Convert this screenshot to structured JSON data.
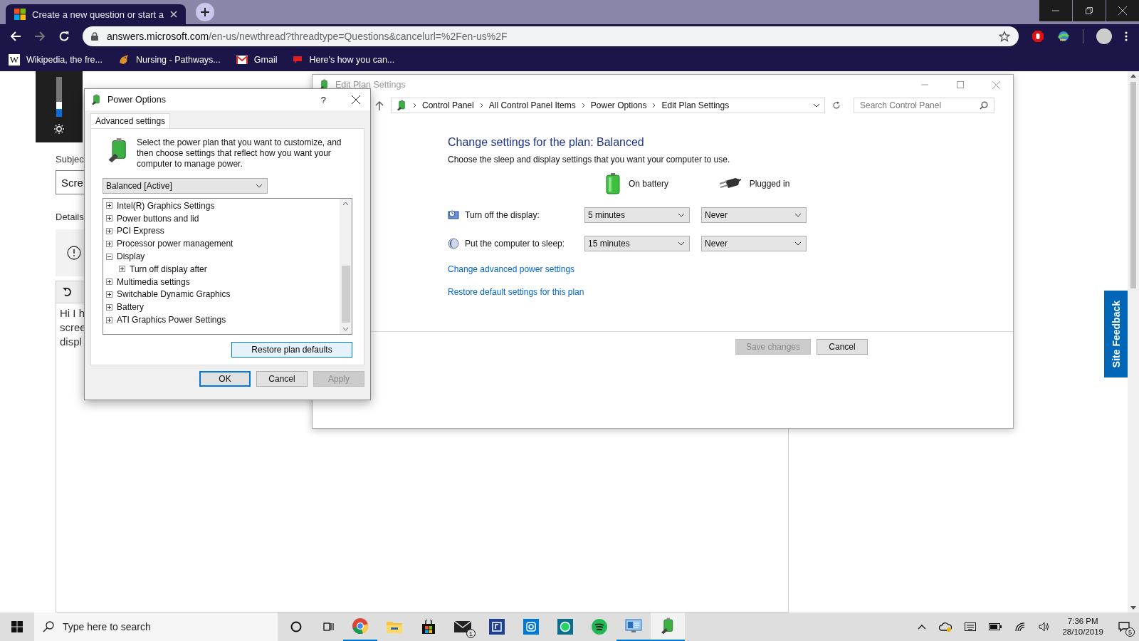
{
  "browser": {
    "tab": {
      "title": "Create a new question or start a",
      "selected": true
    },
    "address": {
      "host": "answers.microsoft.com",
      "path": "/en-us/newthread?threadtype=Questions&cancelurl=%2Fen-us%2F"
    },
    "bookmarks": [
      {
        "kind": "letter",
        "icon": "W",
        "label": "Wikipedia, the fre..."
      },
      {
        "kind": "animal",
        "label": "Nursing - Pathways..."
      },
      {
        "kind": "gmail",
        "label": "Gmail"
      },
      {
        "kind": "red",
        "label": "Here's how you can..."
      }
    ]
  },
  "brightness_flyout": {
    "level": 0.2
  },
  "page": {
    "subject_label": "Subjec",
    "subject_value": "Scre",
    "details_label": "Details",
    "editor_lines": [
      "Hi I h",
      "scree",
      "displ"
    ],
    "feedback_tab": "Site Feedback"
  },
  "edit_plan_window": {
    "title": "Edit Plan Settings",
    "breadcrumb": [
      "Control Panel",
      "All Control Panel Items",
      "Power Options",
      "Edit Plan Settings"
    ],
    "search": {
      "placeholder": "Search Control Panel"
    },
    "heading": "Change settings for the plan: Balanced",
    "subheading": "Choose the sleep and display settings that you want your computer to use.",
    "columns": [
      {
        "kind": "battery",
        "label": "On battery"
      },
      {
        "kind": "plug",
        "label": "Plugged in"
      }
    ],
    "settings": [
      {
        "kind": "display",
        "label": "Turn off the display:",
        "values": [
          "5 minutes",
          "Never"
        ]
      },
      {
        "kind": "sleep",
        "label": "Put the computer to sleep:",
        "values": [
          "15 minutes",
          "Never"
        ]
      }
    ],
    "links": [
      "Change advanced power settings",
      "Restore default settings for this plan"
    ],
    "buttons": [
      {
        "label": "Save changes",
        "disabled": true
      },
      {
        "label": "Cancel",
        "disabled": false
      }
    ]
  },
  "power_options_dialog": {
    "title": "Power Options",
    "help": "?",
    "tabs": [
      {
        "label": "Advanced settings",
        "selected": true
      }
    ],
    "description": "Select the power plan that you want to customize, and then choose settings that reflect how you want your computer to manage power.",
    "plan": "Balanced [Active]",
    "tree": [
      {
        "label": "Intel(R) Graphics Settings",
        "expanded": false
      },
      {
        "label": "Power buttons and lid",
        "expanded": false
      },
      {
        "label": "PCI Express",
        "expanded": false
      },
      {
        "label": "Processor power management",
        "expanded": false
      },
      {
        "label": "Display",
        "expanded": true,
        "children": [
          {
            "label": "Turn off display after",
            "expanded": false
          }
        ]
      },
      {
        "label": "Multimedia settings",
        "expanded": false
      },
      {
        "label": "Switchable Dynamic Graphics",
        "expanded": false
      },
      {
        "label": "Battery",
        "expanded": false
      },
      {
        "label": "ATI Graphics Power Settings",
        "expanded": false
      }
    ],
    "restore_button": "Restore plan defaults",
    "buttons": [
      {
        "label": "OK",
        "default": true,
        "disabled": false
      },
      {
        "label": "Cancel",
        "default": false,
        "disabled": false
      },
      {
        "label": "Apply",
        "default": false,
        "disabled": true
      }
    ]
  },
  "taskbar": {
    "search": {
      "placeholder": "Type here to search"
    },
    "apps": [
      {
        "kind": "chrome",
        "running": true,
        "selected": false
      },
      {
        "kind": "folder",
        "running": false,
        "selected": false
      },
      {
        "kind": "store",
        "running": false,
        "selected": false
      },
      {
        "kind": "mail",
        "running": false,
        "selected": false,
        "badge": "1"
      },
      {
        "kind": "app",
        "running": false,
        "selected": false
      },
      {
        "kind": "camera",
        "running": false,
        "selected": false
      },
      {
        "kind": "chat",
        "running": false,
        "selected": false
      },
      {
        "kind": "music",
        "running": false,
        "selected": false
      },
      {
        "kind": "control",
        "running": true,
        "selected": false
      },
      {
        "kind": "power",
        "running": true,
        "selected": true
      }
    ],
    "time": "7:36 PM",
    "date": "28/10/2019",
    "notifications": "5"
  }
}
